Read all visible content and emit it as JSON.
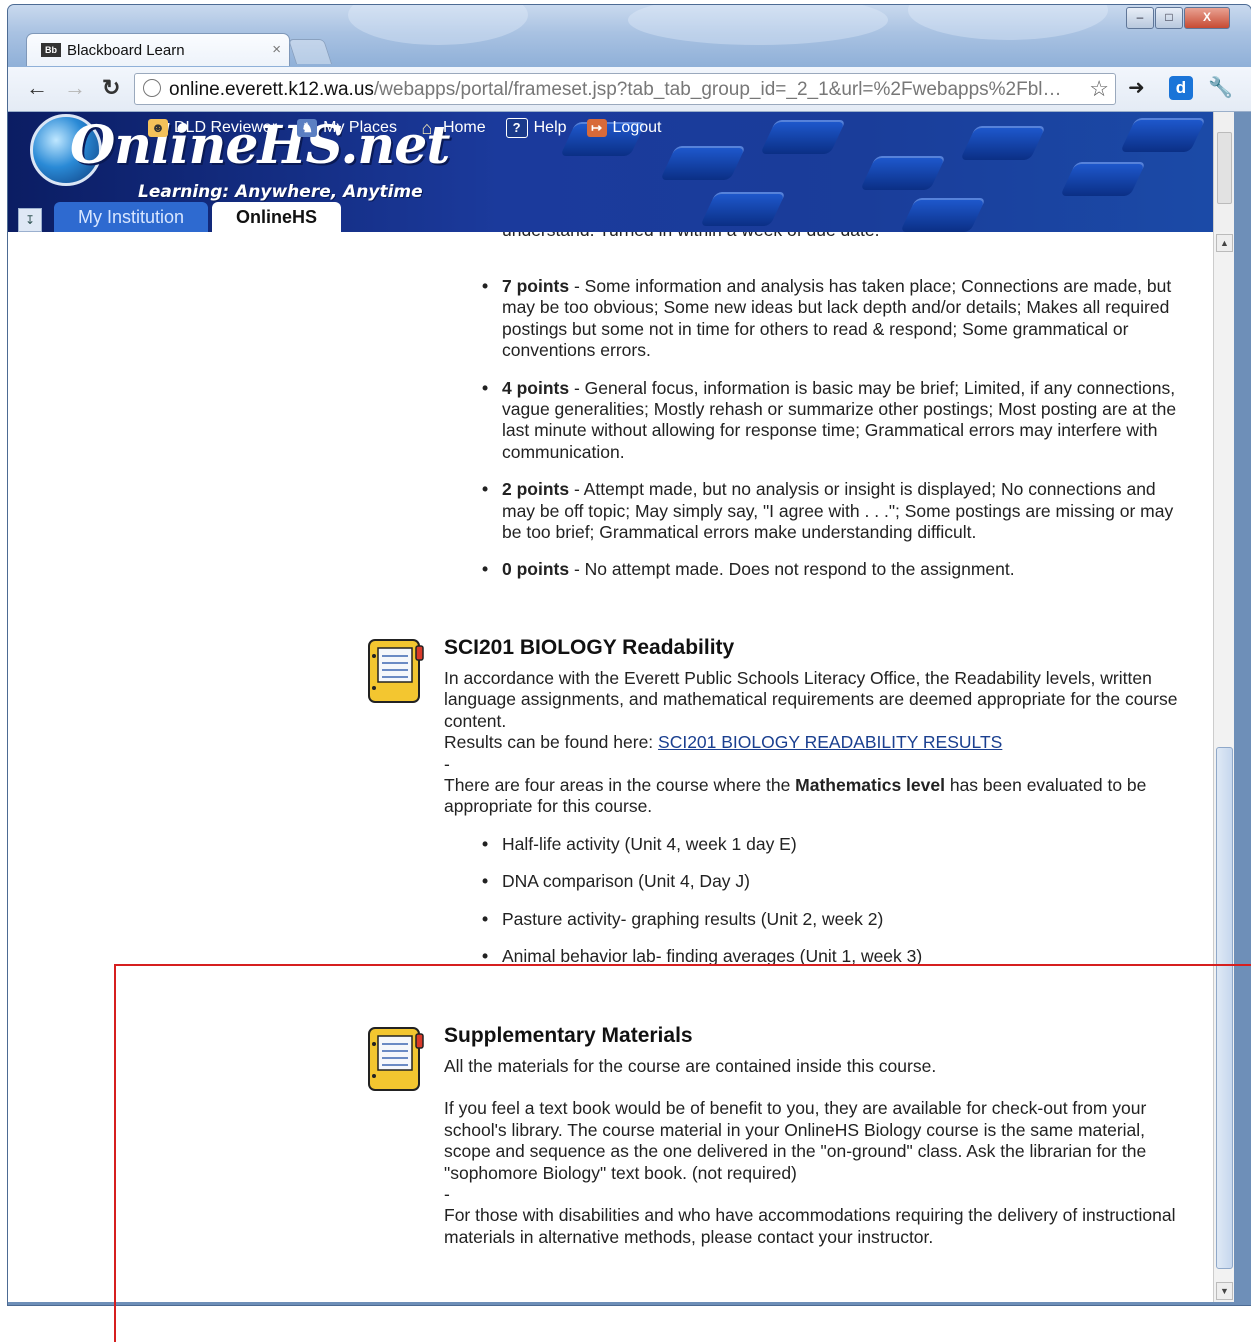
{
  "browser": {
    "tab_title": "Blackboard Learn",
    "tab_favicon": "Bb",
    "tab_close": "×",
    "window_controls": {
      "minimize": "–",
      "maximize": "□",
      "close": "X"
    },
    "url_host": "online.everett.k12.wa.us",
    "url_path": "/webapps/portal/frameset.jsp?tab_tab_group_id=_2_1&url=%2Fwebapps%2Fbl…",
    "nav_icons": {
      "back": "back-arrow-icon",
      "forward": "forward-arrow-icon",
      "reload": "reload-icon"
    },
    "extensions": [
      "exit-icon",
      "d-extension-icon",
      "wrench-icon"
    ]
  },
  "portal": {
    "logo_text": "OnlineHS.net",
    "logo_tagline": "Learning: Anywhere, Anytime",
    "top_nav": [
      {
        "label": "DLD Reviewer",
        "icon": "user-icon"
      },
      {
        "label": "My Places",
        "icon": "people-icon"
      },
      {
        "label": "Home",
        "icon": "home-icon"
      },
      {
        "label": "Help",
        "icon": "help-icon"
      },
      {
        "label": "Logout",
        "icon": "logout-icon"
      }
    ],
    "tabs": [
      {
        "label": "My Institution",
        "active": false
      },
      {
        "label": "OnlineHS",
        "active": true
      }
    ]
  },
  "content": {
    "partial_top_line": "understand. Turned in within a week of due date.",
    "rubric": [
      {
        "points": "7 points",
        "text": " - Some information and analysis has taken place; Connections are made, but may be too obvious; Some new ideas but lack depth and/or details; Makes all required postings but some not in time for others to read & respond; Some grammatical or conventions errors."
      },
      {
        "points": "4 points",
        "text": " - General focus, information is basic may be brief; Limited, if any connections, vague generalities; Mostly rehash or summarize other postings; Most posting are at the last minute without allowing for response time; Grammatical errors may interfere with communication."
      },
      {
        "points": "2 points",
        "text": " - Attempt made, but no analysis or insight is displayed; No connections and may be off topic; May simply say, \"I agree with . . .\"; Some postings are missing or may be too brief; Grammatical errors make understanding difficult."
      },
      {
        "points": "0 points",
        "text": " - No attempt made. Does not respond to the assignment."
      }
    ],
    "readability": {
      "title": "SCI201 BIOLOGY Readability",
      "intro": "In accordance with the Everett Public Schools Literacy Office, the Readability levels, written language assignments, and mathematical requirements are deemed appropriate for the course content.",
      "results_prefix": "Results can be found here: ",
      "results_link": "SCI201 BIOLOGY READABILITY RESULTS",
      "dash": "-",
      "math_prefix": "There are four areas in the course where the ",
      "math_bold": "Mathematics level",
      "math_suffix": " has been evaluated to be appropriate for this course.",
      "math_items": [
        "Half-life activity (Unit 4, week 1 day E)",
        "DNA comparison (Unit 4, Day J)",
        "Pasture activity- graphing results (Unit 2, week 2)",
        "Animal behavior lab- finding averages (Unit 1, week 3)"
      ]
    },
    "supplementary": {
      "title": "Supplementary Materials",
      "p1": "All the materials for the course are contained inside this course.",
      "p2": "If you feel a text book would be of benefit to you, they are available for check-out from your school's library. The course material in your OnlineHS Biology course is the same material, scope and sequence as the one delivered in the \"on-ground\" class. Ask the librarian for the \"sophomore Biology\" text book. (not required)",
      "dash": "-",
      "p3": "For those with disabilities and who have accommodations requiring the delivery of instructional materials in alternative methods, please contact your instructor."
    }
  },
  "colors": {
    "annotation_line": "#d61f1f",
    "link": "#1a3f8f",
    "banner": "#1b3a9c"
  }
}
